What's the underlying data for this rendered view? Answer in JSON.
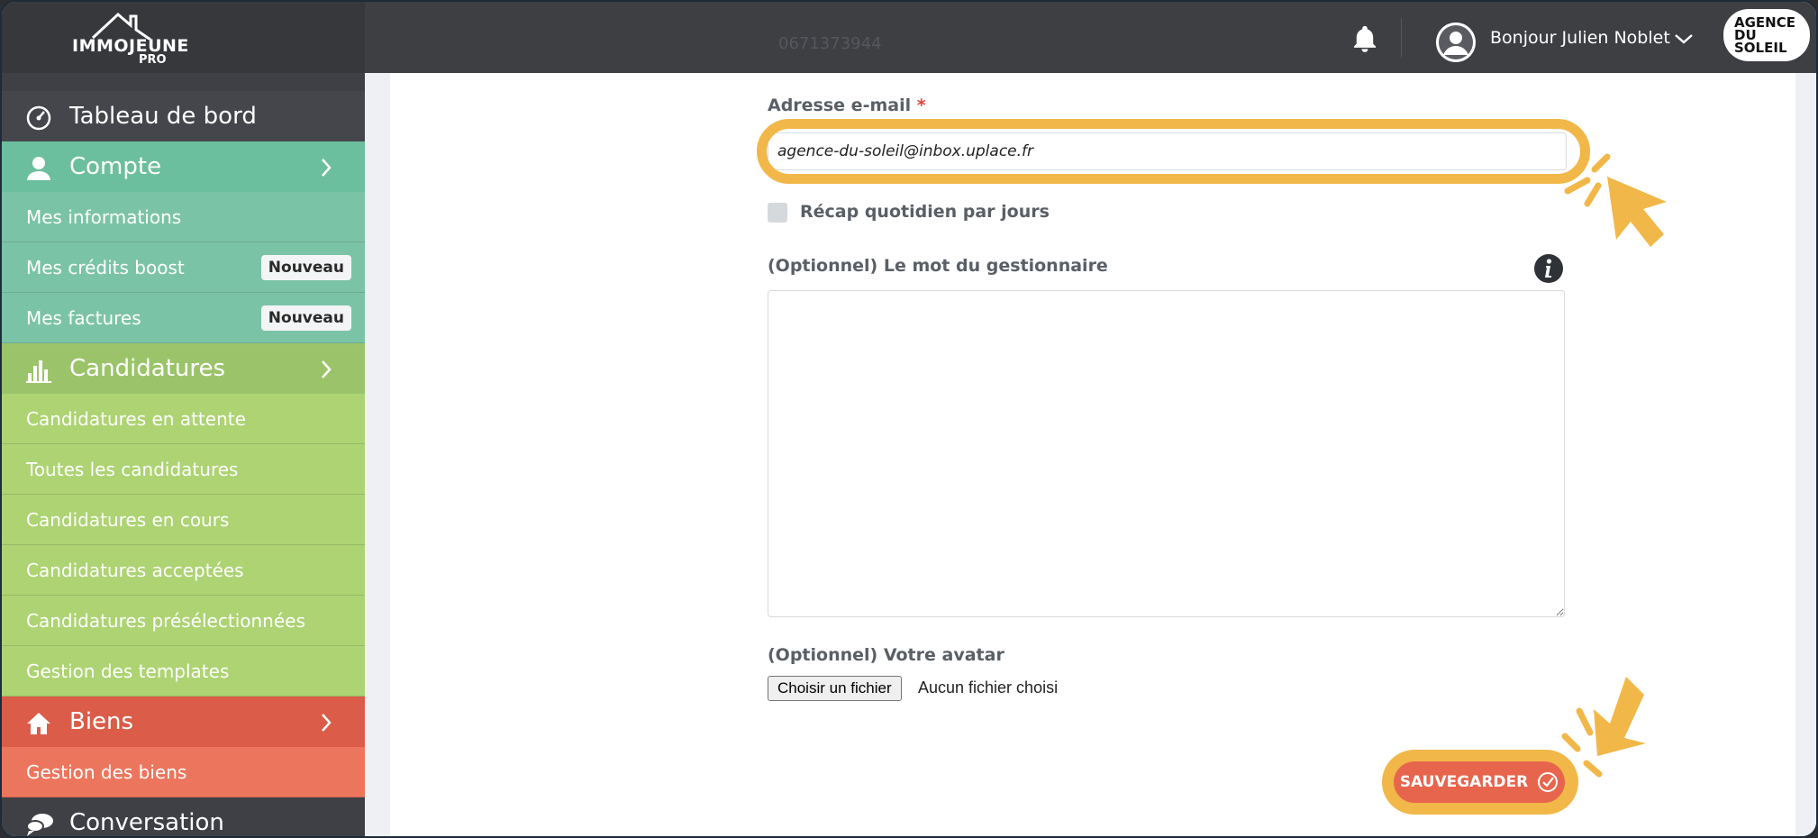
{
  "brand": {
    "name": "IMMOJEUNE",
    "suffix": "PRO"
  },
  "header": {
    "greeting": "Bonjour Julien Noblet",
    "agency_logo_lines": [
      "AGENCE",
      "DU",
      "SOLEIL"
    ],
    "behind_field_value": "0671373944"
  },
  "sidebar": {
    "dashboard": "Tableau de bord",
    "compte": "Compte",
    "compte_items": [
      {
        "label": "Mes informations"
      },
      {
        "label": "Mes crédits boost",
        "badge": "Nouveau"
      },
      {
        "label": "Mes factures",
        "badge": "Nouveau"
      }
    ],
    "candidatures": "Candidatures",
    "candidatures_items": [
      "Candidatures en attente",
      "Toutes les candidatures",
      "Candidatures en cours",
      "Candidatures acceptées",
      "Candidatures présélectionnées",
      "Gestion des templates"
    ],
    "biens": "Biens",
    "biens_items": [
      "Gestion des biens"
    ],
    "conversation": "Conversation"
  },
  "form": {
    "email_label": "Adresse e-mail",
    "required_mark": "*",
    "email_value": "agence-du-soleil@inbox.uplace.fr",
    "recap_label": "Récap quotidien par jours",
    "manager_word_label": "(Optionnel) Le mot du gestionnaire",
    "avatar_label": "(Optionnel) Votre avatar",
    "file_button": "Choisir un fichier",
    "file_none": "Aucun fichier choisi",
    "save_label": "SAUVEGARDER"
  },
  "colors": {
    "topbar": "#3e3f43",
    "compte_green": "#6cbf9e",
    "candidatures_green": "#a3c766",
    "biens_red": "#e0644d",
    "highlight": "#f2b749"
  }
}
